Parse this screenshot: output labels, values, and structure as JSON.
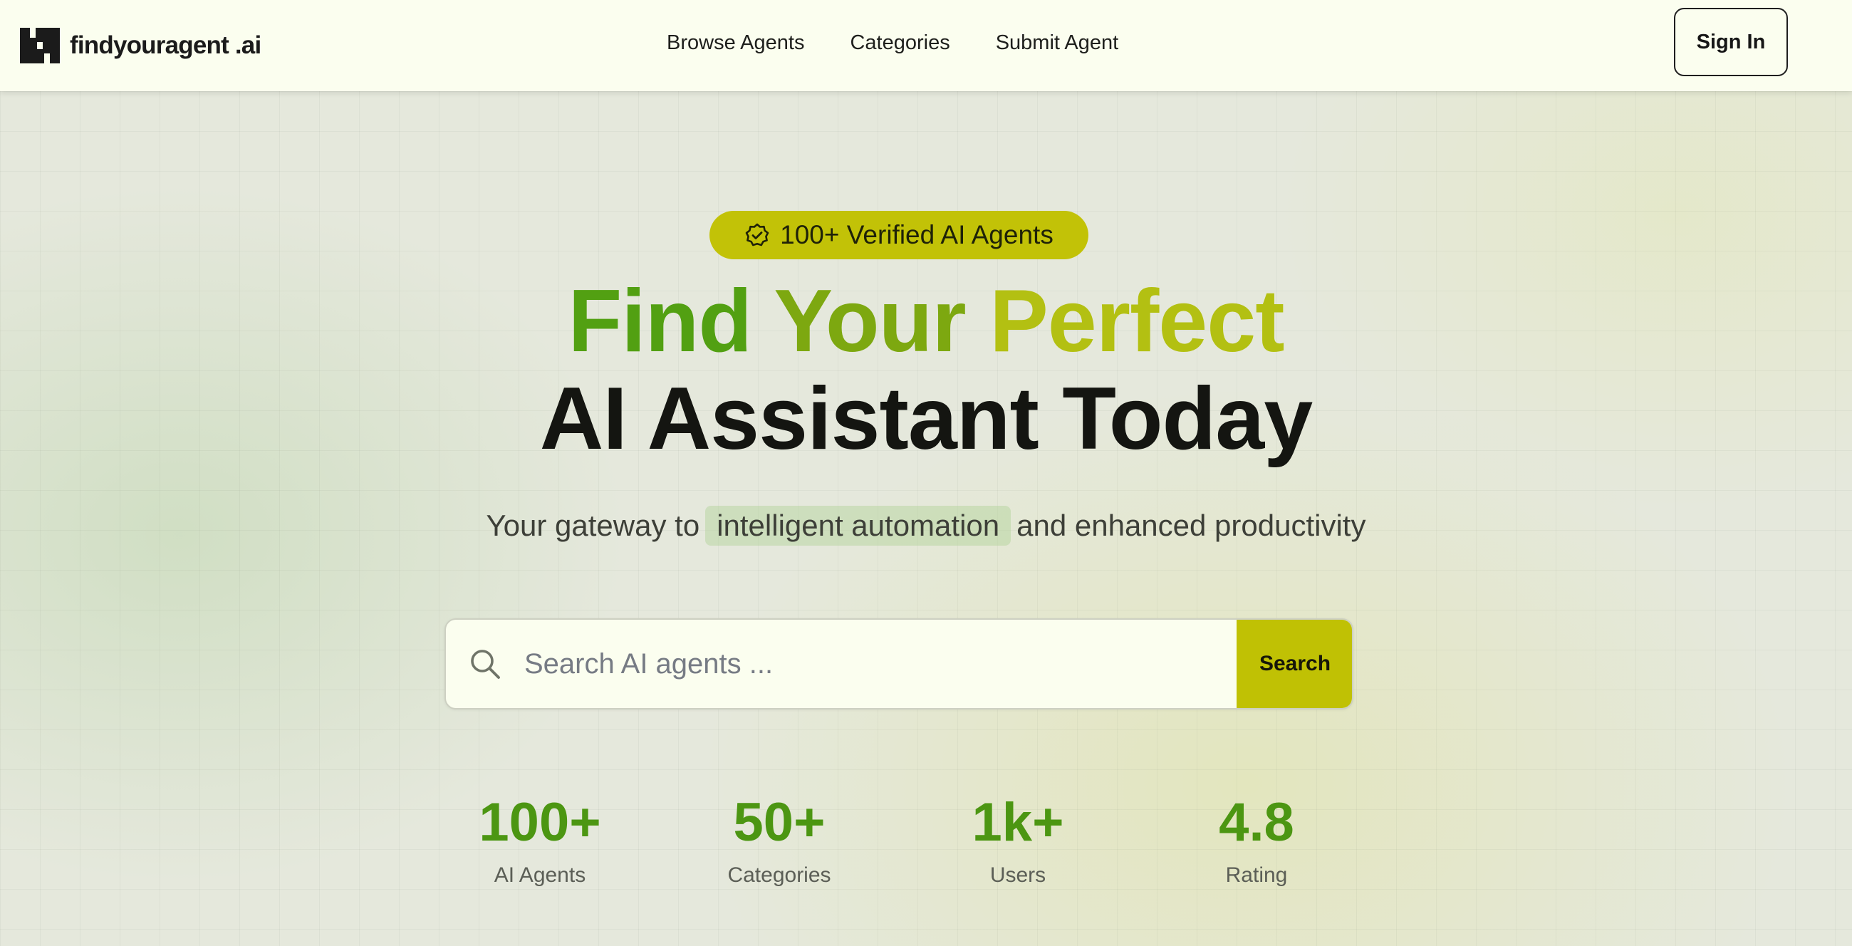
{
  "header": {
    "logo_text": "findyouragent .ai",
    "nav": [
      "Browse Agents",
      "Categories",
      "Submit Agent"
    ],
    "signin_label": "Sign In"
  },
  "hero": {
    "badge": {
      "icon": "verified-badge-icon",
      "text": "100+ Verified AI Agents"
    },
    "headline_line1": [
      "Find",
      "Your",
      "Perfect"
    ],
    "headline_line2": "AI Assistant Today",
    "subtitle_prefix": "Your gateway to",
    "subtitle_highlight": "intelligent automation",
    "subtitle_suffix": "and enhanced productivity"
  },
  "search": {
    "placeholder": "Search AI agents ...",
    "value": "",
    "button_label": "Search",
    "icon": "search-icon"
  },
  "stats": [
    {
      "value": "100+",
      "label": "AI Agents"
    },
    {
      "value": "50+",
      "label": "Categories"
    },
    {
      "value": "1k+",
      "label": "Users"
    },
    {
      "value": "4.8",
      "label": "Rating"
    }
  ],
  "colors": {
    "header_bg": "#fbfeef",
    "page_bg": "#e5e8dc",
    "accent": "#c0c104",
    "headline_green": "#52a012",
    "headline_olive": "#7da810",
    "headline_yellow": "#b3c012",
    "stat_green": "#4c9612",
    "dark_text": "#141511"
  }
}
